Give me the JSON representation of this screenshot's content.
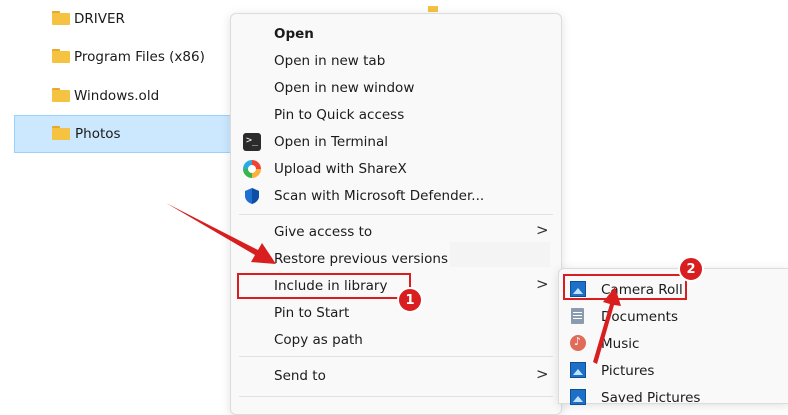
{
  "files": [
    {
      "name": "DRIVER",
      "selected": false
    },
    {
      "name": "Program Files (x86)",
      "selected": false
    },
    {
      "name": "Windows.old",
      "selected": false
    },
    {
      "name": "Photos",
      "selected": true
    }
  ],
  "context_menu": {
    "items": [
      {
        "label": "Open",
        "bold": true,
        "icon": ""
      },
      {
        "label": "Open in new tab",
        "icon": ""
      },
      {
        "label": "Open in new window",
        "icon": ""
      },
      {
        "label": "Pin to Quick access",
        "icon": ""
      },
      {
        "label": "Open in Terminal",
        "icon": "terminal-icon"
      },
      {
        "label": "Upload with ShareX",
        "icon": "sharex-icon"
      },
      {
        "label": "Scan with Microsoft Defender...",
        "icon": "defender-shield-icon"
      },
      {
        "label": "Give access to",
        "submenu": true
      },
      {
        "label": "Restore previous versions"
      },
      {
        "label": "Include in library",
        "submenu": true,
        "highlighted": true
      },
      {
        "label": "Pin to Start"
      },
      {
        "label": "Copy as path"
      },
      {
        "label": "Send to",
        "submenu": true
      }
    ],
    "chevron": ">"
  },
  "library_submenu": {
    "items": [
      {
        "label": "Camera Roll",
        "icon": "picture-library-icon",
        "highlighted": true
      },
      {
        "label": "Documents",
        "icon": "documents-library-icon"
      },
      {
        "label": "Music",
        "icon": "music-library-icon"
      },
      {
        "label": "Pictures",
        "icon": "picture-library-icon"
      },
      {
        "label": "Saved Pictures",
        "icon": "picture-library-icon"
      }
    ]
  },
  "annotations": {
    "badge_1": "1",
    "badge_2": "2",
    "color": "#d81e1e"
  }
}
